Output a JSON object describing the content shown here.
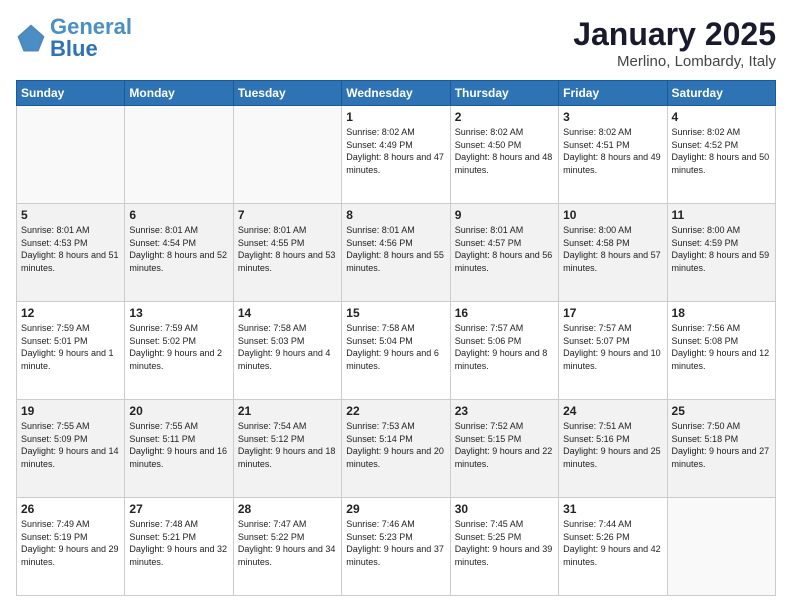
{
  "header": {
    "logo_line1": "General",
    "logo_line2": "Blue",
    "title": "January 2025",
    "subtitle": "Merlino, Lombardy, Italy"
  },
  "weekdays": [
    "Sunday",
    "Monday",
    "Tuesday",
    "Wednesday",
    "Thursday",
    "Friday",
    "Saturday"
  ],
  "weeks": [
    [
      {
        "day": "",
        "info": ""
      },
      {
        "day": "",
        "info": ""
      },
      {
        "day": "",
        "info": ""
      },
      {
        "day": "1",
        "info": "Sunrise: 8:02 AM\nSunset: 4:49 PM\nDaylight: 8 hours and 47 minutes."
      },
      {
        "day": "2",
        "info": "Sunrise: 8:02 AM\nSunset: 4:50 PM\nDaylight: 8 hours and 48 minutes."
      },
      {
        "day": "3",
        "info": "Sunrise: 8:02 AM\nSunset: 4:51 PM\nDaylight: 8 hours and 49 minutes."
      },
      {
        "day": "4",
        "info": "Sunrise: 8:02 AM\nSunset: 4:52 PM\nDaylight: 8 hours and 50 minutes."
      }
    ],
    [
      {
        "day": "5",
        "info": "Sunrise: 8:01 AM\nSunset: 4:53 PM\nDaylight: 8 hours and 51 minutes."
      },
      {
        "day": "6",
        "info": "Sunrise: 8:01 AM\nSunset: 4:54 PM\nDaylight: 8 hours and 52 minutes."
      },
      {
        "day": "7",
        "info": "Sunrise: 8:01 AM\nSunset: 4:55 PM\nDaylight: 8 hours and 53 minutes."
      },
      {
        "day": "8",
        "info": "Sunrise: 8:01 AM\nSunset: 4:56 PM\nDaylight: 8 hours and 55 minutes."
      },
      {
        "day": "9",
        "info": "Sunrise: 8:01 AM\nSunset: 4:57 PM\nDaylight: 8 hours and 56 minutes."
      },
      {
        "day": "10",
        "info": "Sunrise: 8:00 AM\nSunset: 4:58 PM\nDaylight: 8 hours and 57 minutes."
      },
      {
        "day": "11",
        "info": "Sunrise: 8:00 AM\nSunset: 4:59 PM\nDaylight: 8 hours and 59 minutes."
      }
    ],
    [
      {
        "day": "12",
        "info": "Sunrise: 7:59 AM\nSunset: 5:01 PM\nDaylight: 9 hours and 1 minute."
      },
      {
        "day": "13",
        "info": "Sunrise: 7:59 AM\nSunset: 5:02 PM\nDaylight: 9 hours and 2 minutes."
      },
      {
        "day": "14",
        "info": "Sunrise: 7:58 AM\nSunset: 5:03 PM\nDaylight: 9 hours and 4 minutes."
      },
      {
        "day": "15",
        "info": "Sunrise: 7:58 AM\nSunset: 5:04 PM\nDaylight: 9 hours and 6 minutes."
      },
      {
        "day": "16",
        "info": "Sunrise: 7:57 AM\nSunset: 5:06 PM\nDaylight: 9 hours and 8 minutes."
      },
      {
        "day": "17",
        "info": "Sunrise: 7:57 AM\nSunset: 5:07 PM\nDaylight: 9 hours and 10 minutes."
      },
      {
        "day": "18",
        "info": "Sunrise: 7:56 AM\nSunset: 5:08 PM\nDaylight: 9 hours and 12 minutes."
      }
    ],
    [
      {
        "day": "19",
        "info": "Sunrise: 7:55 AM\nSunset: 5:09 PM\nDaylight: 9 hours and 14 minutes."
      },
      {
        "day": "20",
        "info": "Sunrise: 7:55 AM\nSunset: 5:11 PM\nDaylight: 9 hours and 16 minutes."
      },
      {
        "day": "21",
        "info": "Sunrise: 7:54 AM\nSunset: 5:12 PM\nDaylight: 9 hours and 18 minutes."
      },
      {
        "day": "22",
        "info": "Sunrise: 7:53 AM\nSunset: 5:14 PM\nDaylight: 9 hours and 20 minutes."
      },
      {
        "day": "23",
        "info": "Sunrise: 7:52 AM\nSunset: 5:15 PM\nDaylight: 9 hours and 22 minutes."
      },
      {
        "day": "24",
        "info": "Sunrise: 7:51 AM\nSunset: 5:16 PM\nDaylight: 9 hours and 25 minutes."
      },
      {
        "day": "25",
        "info": "Sunrise: 7:50 AM\nSunset: 5:18 PM\nDaylight: 9 hours and 27 minutes."
      }
    ],
    [
      {
        "day": "26",
        "info": "Sunrise: 7:49 AM\nSunset: 5:19 PM\nDaylight: 9 hours and 29 minutes."
      },
      {
        "day": "27",
        "info": "Sunrise: 7:48 AM\nSunset: 5:21 PM\nDaylight: 9 hours and 32 minutes."
      },
      {
        "day": "28",
        "info": "Sunrise: 7:47 AM\nSunset: 5:22 PM\nDaylight: 9 hours and 34 minutes."
      },
      {
        "day": "29",
        "info": "Sunrise: 7:46 AM\nSunset: 5:23 PM\nDaylight: 9 hours and 37 minutes."
      },
      {
        "day": "30",
        "info": "Sunrise: 7:45 AM\nSunset: 5:25 PM\nDaylight: 9 hours and 39 minutes."
      },
      {
        "day": "31",
        "info": "Sunrise: 7:44 AM\nSunset: 5:26 PM\nDaylight: 9 hours and 42 minutes."
      },
      {
        "day": "",
        "info": ""
      }
    ]
  ]
}
